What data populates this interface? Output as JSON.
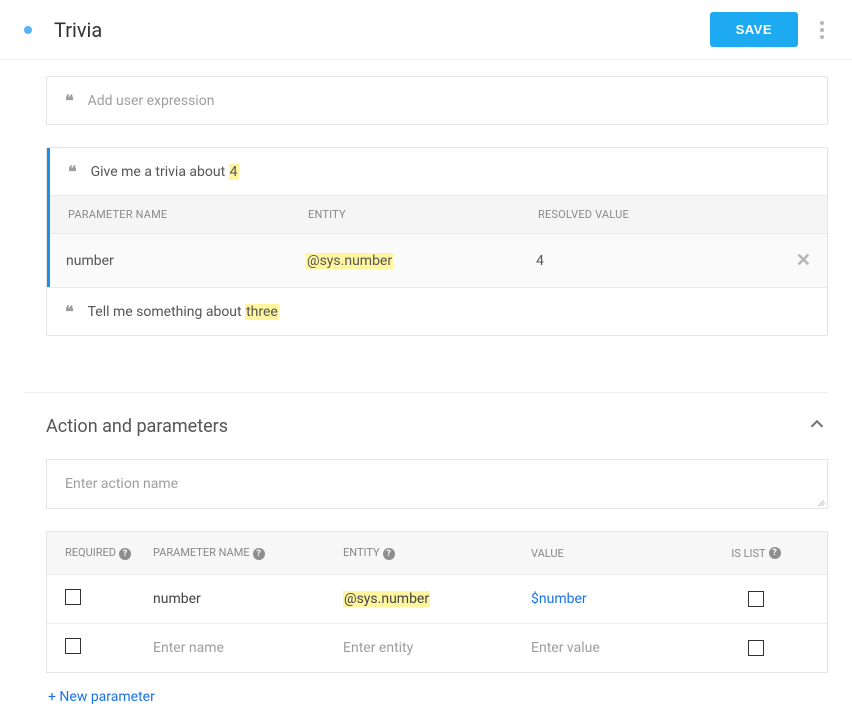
{
  "header": {
    "title": "Trivia",
    "save_label": "SAVE"
  },
  "expr_input_placeholder": "Add user expression",
  "expressions": [
    {
      "prefix": "Give me a trivia about ",
      "highlight": "4",
      "selected": true,
      "param": {
        "name": "number",
        "entity": "@sys.number",
        "resolved": "4"
      },
      "headers": {
        "pname": "PARAMETER NAME",
        "entity": "ENTITY",
        "resolved": "RESOLVED VALUE"
      },
      "close": "✕"
    },
    {
      "prefix": "Tell me something about ",
      "highlight": "three",
      "selected": false
    }
  ],
  "section_title": "Action and parameters",
  "action_placeholder": "Enter action name",
  "params_table": {
    "headers": {
      "required": "REQUIRED",
      "pname": "PARAMETER NAME",
      "entity": "ENTITY",
      "value": "VALUE",
      "islist": "IS LIST"
    },
    "rows": [
      {
        "name": "number",
        "entity": "@sys.number",
        "value": "$number",
        "placeholder": false
      },
      {
        "name": "Enter name",
        "entity": "Enter entity",
        "value": "Enter value",
        "placeholder": true
      }
    ]
  },
  "new_param_label": "+  New parameter"
}
